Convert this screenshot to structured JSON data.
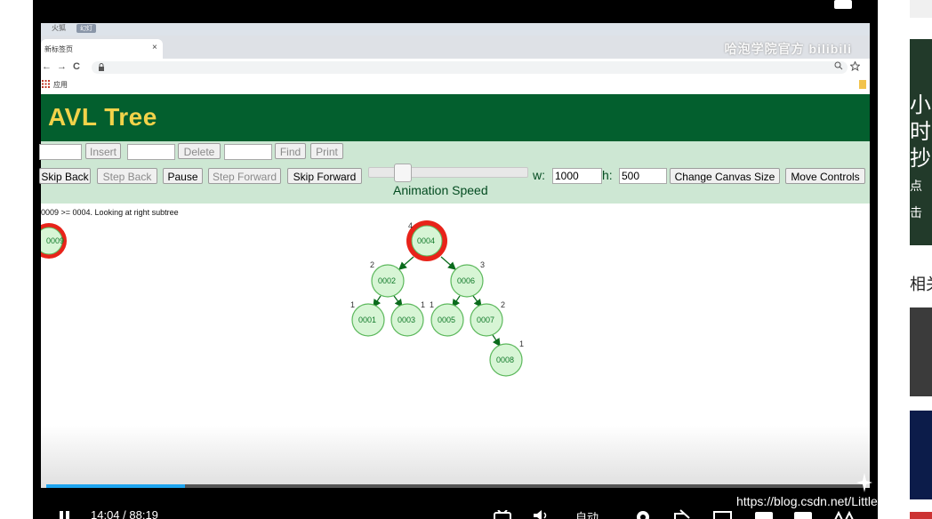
{
  "browser": {
    "top_tabs": [
      "火狐",
      "幻灯"
    ],
    "tab_title": "新标签页",
    "tab_close": "×",
    "watermark": "哈泡学院官方 bilibili",
    "nav": {
      "back": "←",
      "forward": "→",
      "reload": "C"
    },
    "bookmarks_label": "应用"
  },
  "page": {
    "title": "AVL Tree",
    "buttons": {
      "insert": "Insert",
      "delete": "Delete",
      "find": "Find",
      "print": "Print",
      "skip_back": "Skip Back",
      "step_back": "Step Back",
      "pause": "Pause",
      "step_forward": "Step Forward",
      "skip_forward": "Skip Forward",
      "change_canvas": "Change Canvas Size",
      "move_controls": "Move Controls"
    },
    "animation_speed_label": "Animation Speed",
    "w_label": "w:",
    "w_value": "1000",
    "h_label": "h:",
    "h_value": "500",
    "status": "0009 >= 0004.  Looking at right subtree"
  },
  "tree": {
    "inserting": "0009",
    "nodes": [
      {
        "id": "n4",
        "label": "0004",
        "height": "4",
        "highlight": true
      },
      {
        "id": "n2",
        "label": "0002",
        "height": "2"
      },
      {
        "id": "n6",
        "label": "0006",
        "height": "3"
      },
      {
        "id": "n1",
        "label": "0001",
        "height": "1"
      },
      {
        "id": "n3",
        "label": "0003",
        "height": "1"
      },
      {
        "id": "n5",
        "label": "0005",
        "height": "1"
      },
      {
        "id": "n7",
        "label": "0007",
        "height": "2"
      },
      {
        "id": "n8",
        "label": "0008",
        "height": "1"
      }
    ],
    "colors": {
      "node_fill": "#d7f5d5",
      "node_stroke": "#5cb85c",
      "edge": "#0a6b1c",
      "highlight": "#e8231a"
    }
  },
  "player": {
    "time": "14:04 / 88:19",
    "auto_label": "自动",
    "source_watermark": "https://blog.csdn.net/LittleYoY",
    "progress": 0.17
  },
  "side": {
    "related_label": "相关",
    "banner_chars_1": "小",
    "banner_chars_2": "时抄",
    "banner_chars_3": "点击"
  }
}
